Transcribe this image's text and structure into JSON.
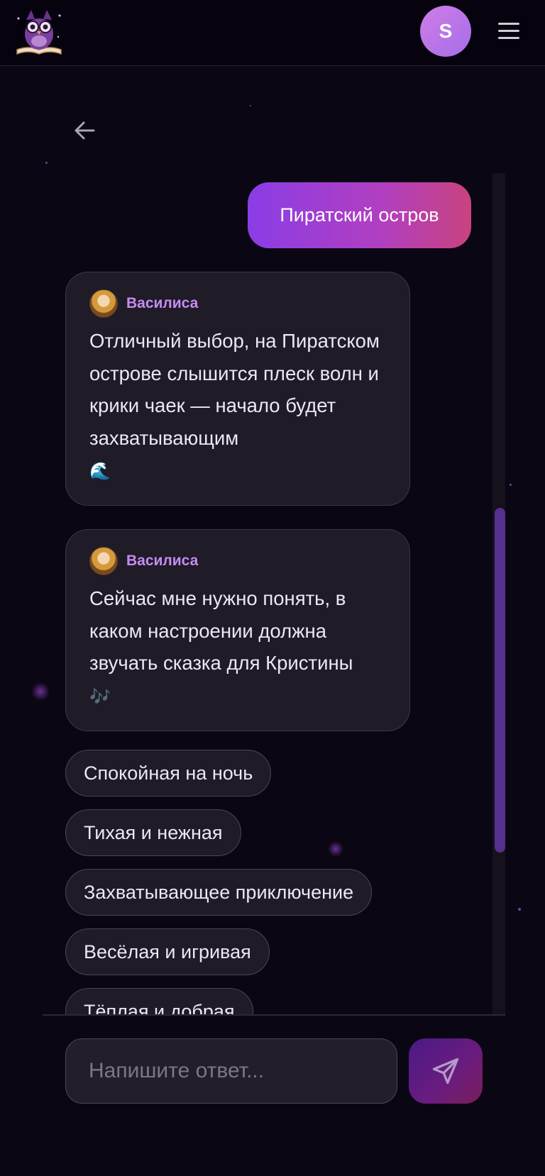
{
  "header": {
    "logo_icon": "owl-on-book-icon",
    "profile_initial": "S",
    "menu_icon": "hamburger-icon"
  },
  "navigation": {
    "back_icon": "arrow-left-icon"
  },
  "chat": {
    "user_message": "Пиратский остров",
    "assistant_messages": [
      {
        "name": "Василиса",
        "text": "Отличный выбор, на Пиратском острове слышится плеск волн и крики чаек — начало будет захватывающим",
        "emoji": "🌊"
      },
      {
        "name": "Василиса",
        "text": "Сейчас мне нужно понять, в каком настроении должна звучать сказка для Кристины",
        "emoji": "🎶"
      }
    ],
    "options": [
      "Спокойная на ночь",
      "Тихая и нежная",
      "Захватывающее приключение",
      "Весёлая и игривая",
      "Тёплая и добрая"
    ]
  },
  "composer": {
    "placeholder": "Напишите ответ...",
    "send_icon": "paper-plane-icon"
  },
  "colors": {
    "background": "#0b0614",
    "accent": "#8a3de6",
    "assistant_name": "#c58cf0",
    "bubble": "#1f1b27"
  }
}
